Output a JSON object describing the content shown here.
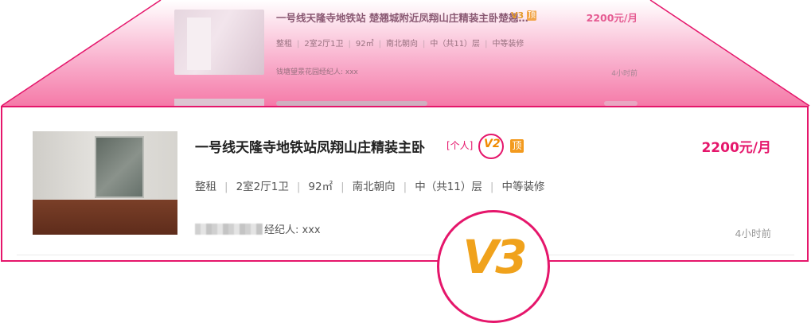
{
  "preview": {
    "title": "一号线天隆寺地铁站 楚翘城附近凤翔山庄精装主卧楚翘…",
    "badge_v": "V3",
    "badge_top": "顶",
    "price": "2200元/月",
    "meta": [
      "整租",
      "2室2厅1卫",
      "92㎡",
      "南北朝向",
      "中（共11）层",
      "中等装修"
    ],
    "agent": "钱塘望景花园经纪人: xxx",
    "time": "4小时前"
  },
  "listing": {
    "title": "一号线天隆寺地铁站凤翔山庄精装主卧",
    "tag": "[个人]",
    "badge_v": "V2",
    "badge_top": "顶",
    "price": "2200元/月",
    "meta": [
      "整租",
      "2室2厅1卫",
      "92㎡",
      "南北朝向",
      "中（共11）层",
      "中等装修"
    ],
    "agent": "经纪人: xxx",
    "time": "4小时前"
  },
  "zoom": {
    "badge_v": "V3"
  },
  "colors": {
    "accent": "#e5166b",
    "badge": "#f08a00",
    "pink_fan": "#f7a6c6"
  },
  "icons": {
    "level_badge": "v-level-icon",
    "top_badge": "top-pin-icon"
  }
}
